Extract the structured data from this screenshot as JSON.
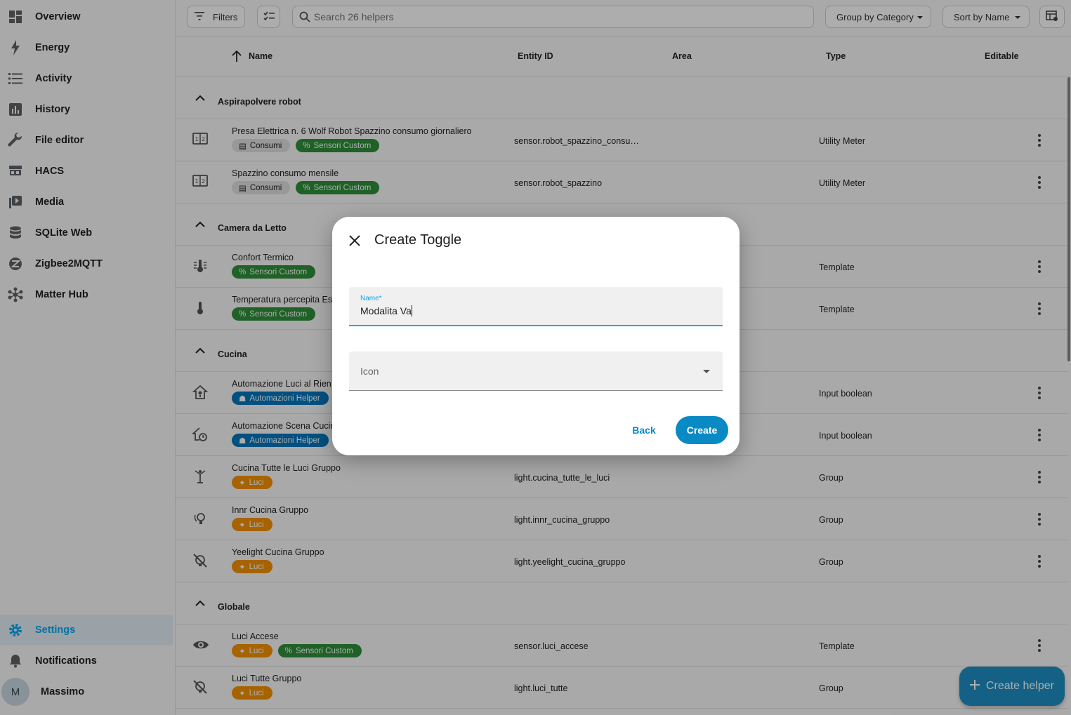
{
  "sidebar": {
    "items": [
      {
        "label": "Overview",
        "icon": "dashboard-icon"
      },
      {
        "label": "Energy",
        "icon": "lightning-bolt-icon"
      },
      {
        "label": "Activity",
        "icon": "list-icon"
      },
      {
        "label": "History",
        "icon": "chart-box-icon"
      },
      {
        "label": "File editor",
        "icon": "wrench-icon"
      },
      {
        "label": "HACS",
        "icon": "hacs-store-icon"
      },
      {
        "label": "Media",
        "icon": "play-box-multiple-icon"
      },
      {
        "label": "SQLite Web",
        "icon": "database-icon"
      },
      {
        "label": "Zigbee2MQTT",
        "icon": "zigbee-icon"
      },
      {
        "label": "Matter Hub",
        "icon": "hub-icon"
      }
    ],
    "settings": "Settings",
    "notifications": "Notifications",
    "user": {
      "initial": "M",
      "name": "Massimo"
    }
  },
  "toolbar": {
    "filters": "Filters",
    "search_placeholder": "Search 26 helpers",
    "group_by": "Group by Category",
    "sort_by": "Sort by Name"
  },
  "table": {
    "columns": {
      "name": "Name",
      "entity_id": "Entity ID",
      "area": "Area",
      "type": "Type",
      "editable": "Editable"
    },
    "groups": [
      {
        "label": "Aspirapolvere robot"
      },
      {
        "label": "Camera da Letto"
      },
      {
        "label": "Cucina"
      },
      {
        "label": "Globale"
      }
    ],
    "rows": [
      {
        "name": "Presa Elettrica n. 6 Wolf Robot Spazzino consumo giornaliero",
        "entity": "sensor.robot_spazzino_consu…",
        "type": "Utility Meter",
        "chips": [
          "Consumi",
          "Sensori Custom"
        ]
      },
      {
        "name": "Spazzino consumo mensile",
        "entity": "sensor.robot_spazzino",
        "type": "Utility Meter",
        "chips": [
          "Consumi",
          "Sensori Custom"
        ]
      },
      {
        "name": "Confort Termico",
        "entity": "",
        "type": "Template",
        "chips": [
          "Sensori Custom"
        ]
      },
      {
        "name": "Temperatura percepita Es",
        "entity": "",
        "type": "Template",
        "chips": [
          "Sensori Custom"
        ]
      },
      {
        "name": "Automazione Luci al Rien",
        "entity": "",
        "type": "Input boolean",
        "chips": [
          "Automazioni Helper"
        ]
      },
      {
        "name": "Automazione Scena Cucir",
        "entity": "",
        "type": "Input boolean",
        "chips": [
          "Automazioni Helper"
        ]
      },
      {
        "name": "Cucina Tutte le Luci Gruppo",
        "entity": "light.cucina_tutte_le_luci",
        "type": "Group",
        "chips": [
          "Luci"
        ]
      },
      {
        "name": "Innr Cucina Gruppo",
        "entity": "light.innr_cucina_gruppo",
        "type": "Group",
        "chips": [
          "Luci"
        ]
      },
      {
        "name": "Yeelight Cucina Gruppo",
        "entity": "light.yeelight_cucina_gruppo",
        "type": "Group",
        "chips": [
          "Luci"
        ]
      },
      {
        "name": "Luci Accese",
        "entity": "sensor.luci_accese",
        "type": "Template",
        "chips": [
          "Luci",
          "Sensori Custom"
        ]
      },
      {
        "name": "Luci Tutte Gruppo",
        "entity": "light.luci_tutte",
        "type": "Group",
        "chips": [
          "Luci"
        ]
      }
    ]
  },
  "fab": {
    "label": "Create helper"
  },
  "dialog": {
    "title": "Create Toggle",
    "name_label": "Name*",
    "name_value": "Modalita Va",
    "icon_label": "Icon",
    "back": "Back",
    "create": "Create"
  },
  "colors": {
    "accent": "#03a9f4",
    "primary_button": "#0a8ac4",
    "chip_green": "#2f8f3a",
    "chip_blue": "#0277bd",
    "chip_orange": "#f59200"
  }
}
